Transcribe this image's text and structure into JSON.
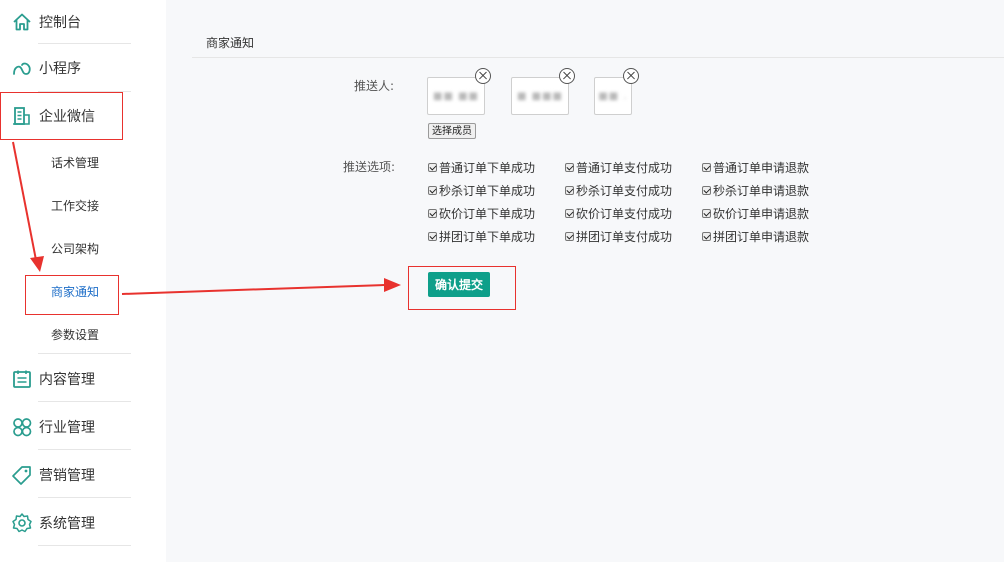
{
  "sidebar": {
    "items": [
      {
        "label": "控制台",
        "icon": "home-icon"
      },
      {
        "label": "小程序",
        "icon": "mini-program-icon"
      },
      {
        "label": "企业微信",
        "icon": "enterprise-wechat-icon"
      },
      {
        "label": "内容管理",
        "icon": "calendar-icon"
      },
      {
        "label": "行业管理",
        "icon": "grid-icon"
      },
      {
        "label": "营销管理",
        "icon": "tag-icon"
      },
      {
        "label": "系统管理",
        "icon": "gear-icon"
      }
    ],
    "sub_items": [
      {
        "label": "话术管理"
      },
      {
        "label": "工作交接"
      },
      {
        "label": "公司架构"
      },
      {
        "label": "商家通知",
        "active": true
      },
      {
        "label": "参数设置"
      }
    ]
  },
  "main": {
    "title": "商家通知",
    "pusher_label": "推送人:",
    "members": [
      "■■ ■■",
      "■ ■■■",
      "■■ ."
    ],
    "select_button": "选择成员",
    "options_label": "推送选项:",
    "options": [
      [
        "普通订单下单成功",
        "普通订单支付成功",
        "普通订单申请退款"
      ],
      [
        "秒杀订单下单成功",
        "秒杀订单支付成功",
        "秒杀订单申请退款"
      ],
      [
        "砍价订单下单成功",
        "砍价订单支付成功",
        "砍价订单申请退款"
      ],
      [
        "拼团订单下单成功",
        "拼团订单支付成功",
        "拼团订单申请退款"
      ]
    ],
    "submit_button": "确认提交"
  },
  "colors": {
    "accent": "#0e9f8a",
    "icon": "#2a9d8f",
    "annotation": "#e8322e"
  }
}
